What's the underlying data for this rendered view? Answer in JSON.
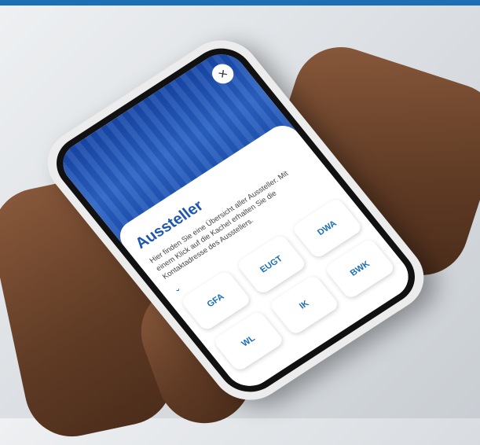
{
  "page": {
    "colors": {
      "accent": "#1c6fb4",
      "title": "#1c56b0",
      "hero": "#1747a8"
    }
  },
  "modal": {
    "close_icon_glyph": "×",
    "title": "Aussteller",
    "description": "Hier finden Sie eine Übersicht aller Aussteller. Mit einem Klick auf die Kachel erhalten Sie die Kontaktadresse des Ausstellers.",
    "chevron_glyph": "⌄"
  },
  "exhibitors": [
    {
      "label": "GFA"
    },
    {
      "label": "EUGT"
    },
    {
      "label": "DWA"
    },
    {
      "label": "WL"
    },
    {
      "label": "IK"
    },
    {
      "label": "BWK"
    }
  ]
}
